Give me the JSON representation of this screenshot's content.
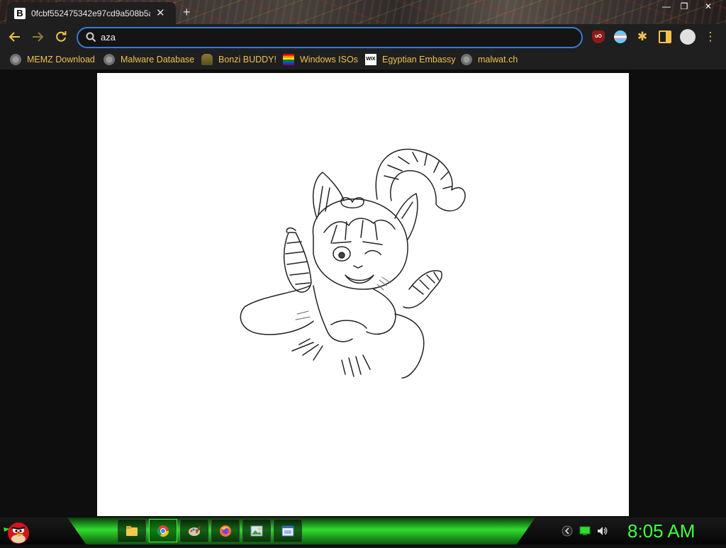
{
  "browser": {
    "tab": {
      "favicon_letter": "B",
      "title": "0fcbf552475342e97cd9a508b5a",
      "close_glyph": "✕"
    },
    "new_tab_glyph": "+",
    "window_controls": {
      "minimize": "—",
      "maximize": "❐",
      "close": "✕"
    },
    "toolbar": {
      "back_icon": "arrow-left-icon",
      "forward_icon": "arrow-right-icon",
      "reload_icon": "reload-icon",
      "address_text": "aza",
      "accent_color": "#f2c14e",
      "focus_ring_color": "#3a7bd5"
    },
    "extensions": {
      "ublock_label": "uO",
      "menu_glyph": "⋮",
      "puzzle_glyph": "✱"
    },
    "bookmarks": [
      {
        "label": "MEMZ Download",
        "icon": "globe-icon"
      },
      {
        "label": "Malware Database",
        "icon": "globe-icon"
      },
      {
        "label": "Bonzi BUDDY!",
        "icon": "bonzi-icon"
      },
      {
        "label": "Windows ISOs",
        "icon": "rainbow-flag-icon"
      },
      {
        "label": "Egyptian Embassy",
        "icon": "wix-icon"
      },
      {
        "label": "malwat.ch",
        "icon": "globe-icon"
      }
    ],
    "wix_text": "WIX"
  },
  "content": {
    "image_subject": "sketch-drawing"
  },
  "taskbar": {
    "clock": "8:05 AM",
    "apps": [
      "file-explorer-icon",
      "chrome-icon",
      "paint-icon",
      "firefox-icon",
      "image-viewer-icon",
      "window-icon"
    ],
    "accent_color": "#3fff3f"
  }
}
